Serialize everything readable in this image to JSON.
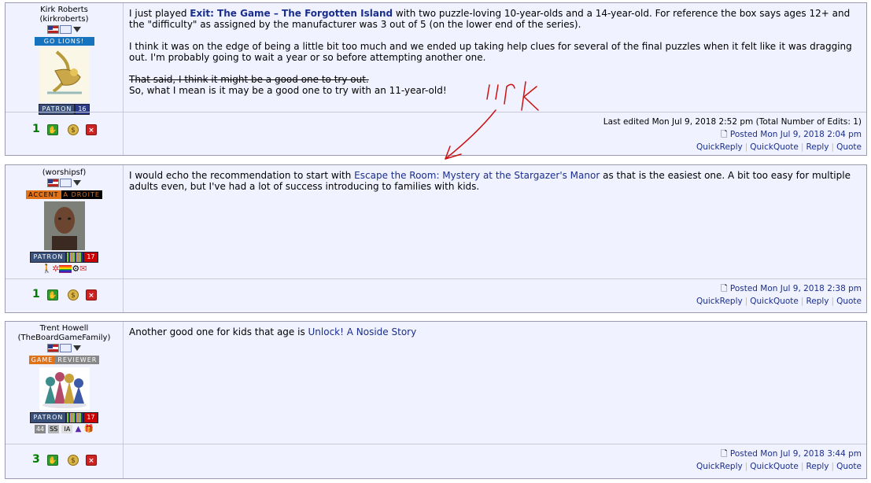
{
  "posts": [
    {
      "user": {
        "name": "Kirk Roberts",
        "handle": "(kirkroberts)",
        "badge": "GO LIONS!",
        "patron_label": "PATRON",
        "patron_years": "16"
      },
      "content": {
        "p1_pre": "I just played ",
        "game1": "Exit: The Game – The Forgotten Island",
        "p1_post": " with two puzzle-loving 10-year-olds and a 14-year-old. For reference the box says ages 12+ and the \"difficulty\" as assigned by the manufacturer was 3 out of 5 (on the lower end of the series).",
        "p2": "I think it was on the edge of being a little bit too much and we ended up taking help clues for several of the final puzzles when it felt like it was dragging out. I'm probably going to wait a year or so before attempting another one.",
        "p3_strike": "That said, I think it might be a good one to try out.",
        "p3_after": "So, what I mean is it may be a good one to try with an 11-year-old!"
      },
      "thumbs": "1",
      "edited": "Last edited Mon Jul 9, 2018 2:52 pm (Total Number of Edits: 1)",
      "posted": "Posted Mon Jul 9, 2018 2:04 pm"
    },
    {
      "user": {
        "name": "",
        "handle": "(worshipsf)",
        "badge_left": "ACCENT",
        "badge_right": "A DROITE",
        "patron_label": "PATRON",
        "patron_years": "17"
      },
      "content": {
        "pre": "I would echo the recommendation to start with ",
        "game": "Escape the Room: Mystery at the Stargazer's Manor",
        "post": " as that is the easiest one. A bit too easy for multiple adults even, but I've had a lot of success introducing to families with kids."
      },
      "thumbs": "1",
      "posted": "Posted Mon Jul 9, 2018 2:38 pm"
    },
    {
      "user": {
        "name": "Trent Howell",
        "handle": "(TheBoardGameFamily)",
        "badge_left": "GAME",
        "badge_right": "REVIEWER",
        "patron_label": "PATRON",
        "patron_years": "17"
      },
      "content": {
        "pre": "Another good one for kids that age is ",
        "game": "Unlock! A Noside Story"
      },
      "thumbs": "3",
      "posted": "Posted Mon Jul 9, 2018 3:44 pm"
    }
  ],
  "actions": {
    "quickreply": "QuickReply",
    "quickquote": "QuickQuote",
    "reply": "Reply",
    "quote": "Quote"
  },
  "annotation": {
    "text": "link",
    "color": "#cc1111"
  }
}
